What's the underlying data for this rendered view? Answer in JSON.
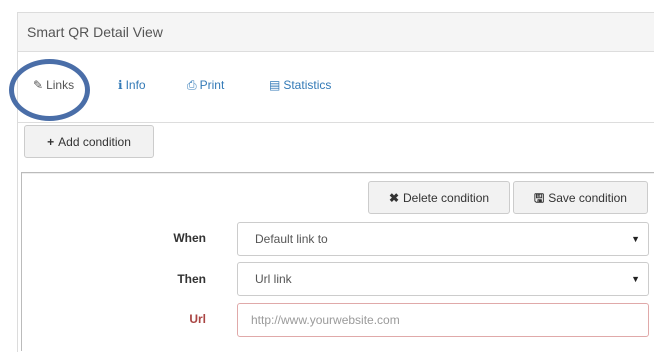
{
  "panel": {
    "title": "Smart QR Detail View"
  },
  "tabs": [
    {
      "label": "Links",
      "icon": "link-icon",
      "glyph": "✎",
      "active": true
    },
    {
      "label": "Info",
      "icon": "info-icon",
      "glyph": "ℹ",
      "active": false
    },
    {
      "label": "Print",
      "icon": "print-icon",
      "glyph": "⎙",
      "active": false
    },
    {
      "label": "Statistics",
      "icon": "chart-icon",
      "glyph": "▤",
      "active": false
    }
  ],
  "toolbar": {
    "add_condition_label": "Add condition",
    "add_condition_glyph": "+"
  },
  "condition": {
    "delete_label": "Delete condition",
    "delete_glyph": "✖",
    "save_label": "Save condition",
    "save_glyph": "🖫",
    "when_label": "When",
    "when_value": "Default link to",
    "then_label": "Then",
    "then_value": "Url link",
    "url_label": "Url",
    "url_placeholder": "http://www.yourwebsite.com",
    "url_value": "",
    "caret_glyph": "▼"
  },
  "colors": {
    "link": "#337ab7",
    "highlight_circle": "#4a6ea8",
    "required_label": "#a94442"
  }
}
